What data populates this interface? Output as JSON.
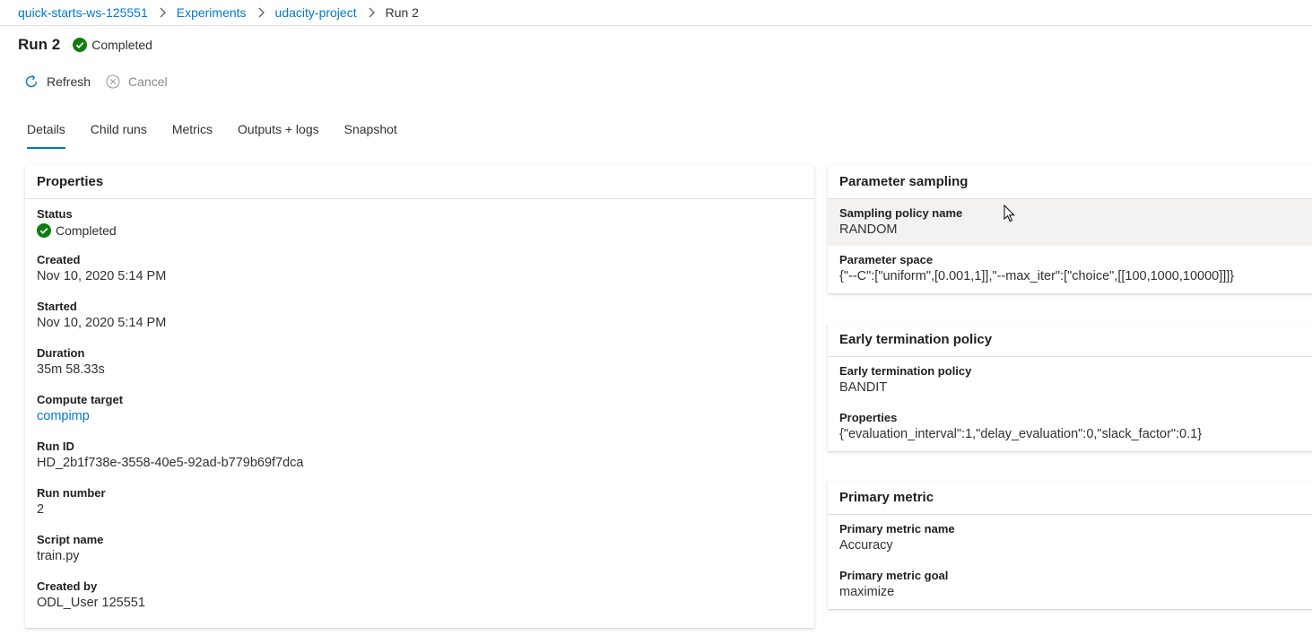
{
  "breadcrumb": {
    "items": [
      "quick-starts-ws-125551",
      "Experiments",
      "udacity-project"
    ],
    "current": "Run 2"
  },
  "header": {
    "title": "Run 2",
    "status": "Completed",
    "status_color": "#107c10"
  },
  "toolbar": {
    "refresh_label": "Refresh",
    "cancel_label": "Cancel"
  },
  "tabs": [
    {
      "label": "Details",
      "active": true
    },
    {
      "label": "Child runs"
    },
    {
      "label": "Metrics"
    },
    {
      "label": "Outputs + logs"
    },
    {
      "label": "Snapshot"
    }
  ],
  "properties": {
    "title": "Properties",
    "status_label": "Status",
    "status_value": "Completed",
    "created_label": "Created",
    "created_value": "Nov 10, 2020 5:14 PM",
    "started_label": "Started",
    "started_value": "Nov 10, 2020 5:14 PM",
    "duration_label": "Duration",
    "duration_value": "35m 58.33s",
    "compute_label": "Compute target",
    "compute_value": "compimp",
    "runid_label": "Run ID",
    "runid_value": "HD_2b1f738e-3558-40e5-92ad-b779b69f7dca",
    "runnumber_label": "Run number",
    "runnumber_value": "2",
    "script_label": "Script name",
    "script_value": "train.py",
    "createdby_label": "Created by",
    "createdby_value": "ODL_User 125551"
  },
  "parameter_sampling": {
    "title": "Parameter sampling",
    "policy_label": "Sampling policy name",
    "policy_value": "RANDOM",
    "space_label": "Parameter space",
    "space_value": "{\"--C\":[\"uniform\",[0.001,1]],\"--max_iter\":[\"choice\",[[100,1000,10000]]]}"
  },
  "early_termination": {
    "title": "Early termination policy",
    "policy_label": "Early termination policy",
    "policy_value": "BANDIT",
    "props_label": "Properties",
    "props_value": "{\"evaluation_interval\":1,\"delay_evaluation\":0,\"slack_factor\":0.1}"
  },
  "primary_metric": {
    "title": "Primary metric",
    "name_label": "Primary metric name",
    "name_value": "Accuracy",
    "goal_label": "Primary metric goal",
    "goal_value": "maximize"
  },
  "colors": {
    "accent": "#0078d4",
    "success": "#107c10",
    "text": "#323130",
    "muted": "#8a8886"
  }
}
